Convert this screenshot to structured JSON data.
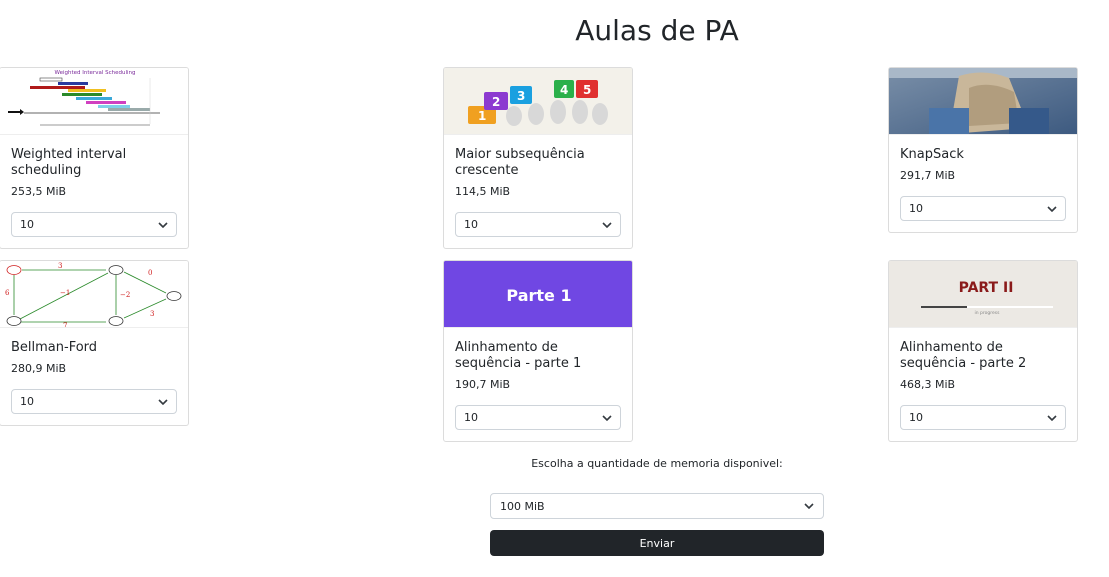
{
  "page": {
    "title": "Aulas de PA"
  },
  "cards": [
    {
      "name": "Weighted interval scheduling",
      "size": "253,5 MiB",
      "select": "10"
    },
    {
      "name": "Maior subsequência crescente",
      "size": "114,5 MiB",
      "select": "10"
    },
    {
      "name": "KnapSack",
      "size": "291,7 MiB",
      "select": "10"
    },
    {
      "name": "Bellman-Ford",
      "size": "280,9 MiB",
      "select": "10"
    },
    {
      "name": "Alinhamento de sequência - parte 1",
      "size": "190,7 MiB",
      "select": "10"
    },
    {
      "name": "Alinhamento de sequência - parte 2",
      "size": "468,3 MiB",
      "select": "10"
    }
  ],
  "thumbs": {
    "wis_title": "Weighted Interval Scheduling",
    "subseq_numbers": [
      "1",
      "2",
      "3",
      "4",
      "5"
    ],
    "parte1_text": "Parte 1",
    "part2_text": "PART II",
    "part2_sub": "in progress"
  },
  "form": {
    "label": "Escolha a quantidade de memoria disponivel:",
    "memory_value": "100 MiB",
    "submit_label": "Enviar"
  },
  "colors": {
    "button_bg": "#212529",
    "parte1_bg": "#6b3fe0"
  },
  "icons": {
    "select_arrow": "chevron-down-icon"
  }
}
